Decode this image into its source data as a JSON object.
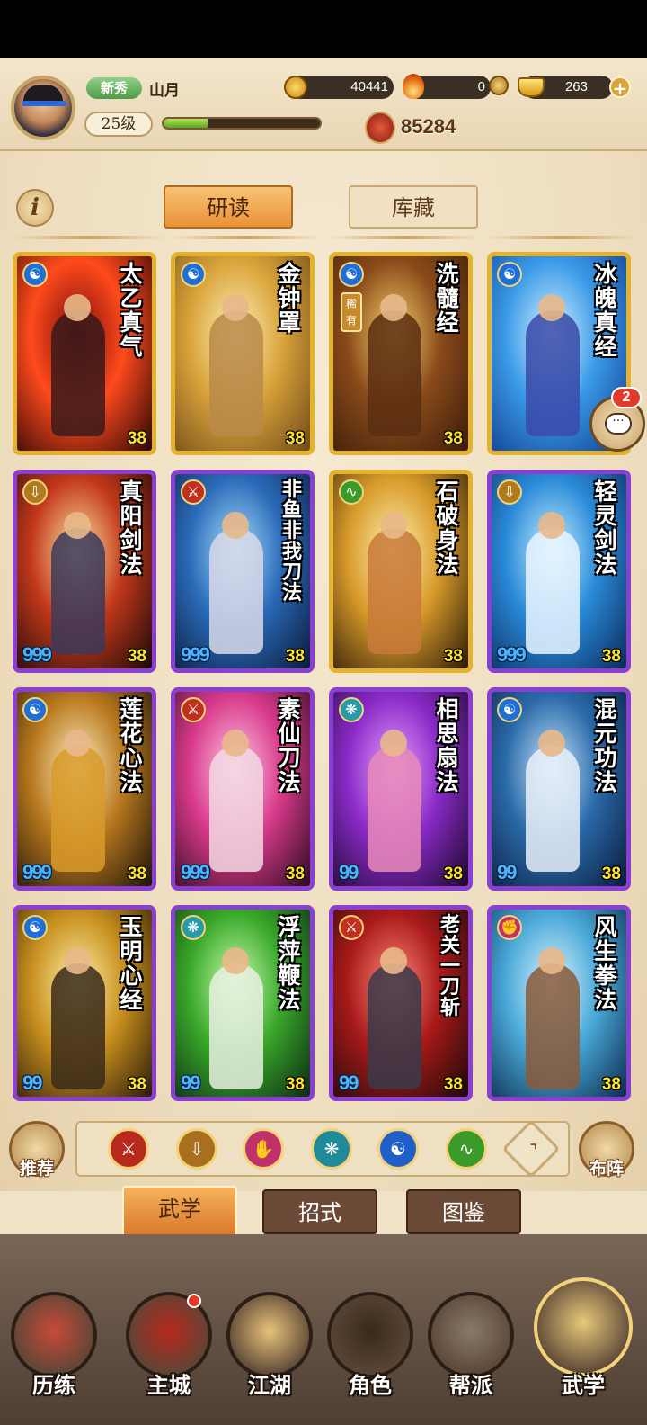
{
  "player": {
    "rank_badge": "新秀",
    "name": "山月",
    "level": "25级",
    "xp_fraction": 0.28
  },
  "currencies": {
    "coins": "40441",
    "flame": "0",
    "ingots": "263"
  },
  "power": "85284",
  "tabs": {
    "study": "研读",
    "storage": "库藏"
  },
  "chat_badge": "2",
  "icon_glyphs": {
    "yin_yang": "☯",
    "sword": "⚔",
    "spear": "⇩",
    "fan": "❋",
    "fist": "✊",
    "palm": "✋",
    "whip": "∿",
    "up": "⌃"
  },
  "cards": [
    {
      "title": "太乙真气",
      "level": "38",
      "count": "",
      "rarity": "gold",
      "type_icon": "yin-yang-icon",
      "type_color": "#1e6fd6",
      "art": [
        "#7a0d0d",
        "#ff4a1c",
        "#2a0606"
      ],
      "fig": "#3a1a1a"
    },
    {
      "title": "金钟罩",
      "level": "38",
      "count": "",
      "rarity": "gold",
      "type_icon": "yin-yang-icon",
      "type_color": "#1e6fd6",
      "art": [
        "#fff0b8",
        "#d9a33a",
        "#6e4a18"
      ],
      "fig": "#b88a4a"
    },
    {
      "title": "洗髓经",
      "level": "38",
      "count": "",
      "rarity": "gold",
      "type_icon": "yin-yang-icon",
      "type_color": "#1e6fd6",
      "rare_tag": "稀有",
      "art": [
        "#f6d36a",
        "#8a4a1a",
        "#3a1c0a"
      ],
      "fig": "#5a2e12"
    },
    {
      "title": "冰魄真经",
      "level": "38",
      "count": "",
      "rarity": "gold",
      "type_icon": "yin-yang-icon",
      "type_color": "#1e6fd6",
      "art": [
        "#d6f2ff",
        "#3a9ae8",
        "#0e3a8a"
      ],
      "fig": "#3a4aa8"
    },
    {
      "title": "真阳剑法",
      "level": "38",
      "count": "999",
      "rarity": "purple",
      "type_icon": "sword-icon",
      "type_color": "#b07a1e",
      "art": [
        "#ffe4a0",
        "#c2381a",
        "#1a0808"
      ],
      "fig": "#3a3a5a"
    },
    {
      "title": "非鱼非我刀法",
      "level": "38",
      "count": "999",
      "rarity": "purple",
      "type_icon": "blade-icon",
      "type_color": "#c0301e",
      "art": [
        "#a8e0ff",
        "#2a6ab8",
        "#0a1a3a"
      ],
      "fig": "#d8d8e8"
    },
    {
      "title": "石破身法",
      "level": "38",
      "count": "",
      "rarity": "gold",
      "type_icon": "boot-icon",
      "type_color": "#3a9a2a",
      "art": [
        "#fff2b0",
        "#d89a2a",
        "#2a1a08"
      ],
      "fig": "#c87a3a"
    },
    {
      "title": "轻灵剑法",
      "level": "38",
      "count": "999",
      "rarity": "purple",
      "type_icon": "sword-icon",
      "type_color": "#b07a1e",
      "art": [
        "#c8f2ff",
        "#2a8ad8",
        "#0a2a5a"
      ],
      "fig": "#e8f4ff"
    },
    {
      "title": "莲花心法",
      "level": "38",
      "count": "999",
      "rarity": "purple",
      "type_icon": "yin-yang-icon",
      "type_color": "#1e6fd6",
      "art": [
        "#fff0c0",
        "#b8781e",
        "#1a1208"
      ],
      "fig": "#d89a2a"
    },
    {
      "title": "素仙刀法",
      "level": "38",
      "count": "999",
      "rarity": "purple",
      "type_icon": "blade-icon",
      "type_color": "#c0301e",
      "art": [
        "#ffc8e8",
        "#d83a8a",
        "#2a0a1e"
      ],
      "fig": "#f2d8e2"
    },
    {
      "title": "相思扇法",
      "level": "38",
      "count": "99",
      "rarity": "purple",
      "type_icon": "fan-icon",
      "type_color": "#2a9aa8",
      "art": [
        "#e8a0ff",
        "#8a2ac8",
        "#1a0828"
      ],
      "fig": "#e88ab8"
    },
    {
      "title": "混元功法",
      "level": "38",
      "count": "99",
      "rarity": "purple",
      "type_icon": "yin-yang-icon",
      "type_color": "#1e6fd6",
      "art": [
        "#c8e8ff",
        "#2a6aa8",
        "#0a1a3a"
      ],
      "fig": "#e8eef8"
    },
    {
      "title": "玉明心经",
      "level": "38",
      "count": "99",
      "rarity": "purple",
      "type_icon": "yin-yang-icon",
      "type_color": "#1e6fd6",
      "art": [
        "#fff0a8",
        "#c8901e",
        "#2a1a08"
      ],
      "fig": "#3a2a1a"
    },
    {
      "title": "浮萍鞭法",
      "level": "38",
      "count": "99",
      "rarity": "purple",
      "type_icon": "fan-icon",
      "type_color": "#2a9aa8",
      "art": [
        "#c8ffb0",
        "#3aa82a",
        "#0a2a12"
      ],
      "fig": "#e8f0e0"
    },
    {
      "title": "老关一刀斩",
      "level": "38",
      "count": "99",
      "rarity": "purple",
      "type_icon": "blade-icon",
      "type_color": "#c0301e",
      "art": [
        "#ff8a7a",
        "#a81a1a",
        "#1a0808"
      ],
      "fig": "#3a3a4a"
    },
    {
      "title": "风生拳法",
      "level": "38",
      "count": "",
      "rarity": "purple",
      "type_icon": "fist-icon",
      "type_color": "#c0306a",
      "art": [
        "#d8f4ff",
        "#4aa8d8",
        "#0a2a4a"
      ],
      "fig": "#8a5a3a"
    }
  ],
  "side_buttons": {
    "recommend": "推荐",
    "formation": "布阵"
  },
  "filters": [
    {
      "name": "blade",
      "color": "#b82a1e"
    },
    {
      "name": "sword",
      "color": "#a8701e"
    },
    {
      "name": "fist",
      "color": "#c0306a"
    },
    {
      "name": "fan",
      "color": "#1e8a9a"
    },
    {
      "name": "yin-yang",
      "color": "#1e5fc8"
    },
    {
      "name": "boot",
      "color": "#3a9a2a"
    },
    {
      "name": "up-arrow",
      "color": "#f0e4c8"
    }
  ],
  "subtabs": {
    "martial": "武学",
    "moves": "招式",
    "codex": "图鉴"
  },
  "nav": [
    "历练",
    "主城",
    "江湖",
    "角色",
    "帮派",
    "武学"
  ]
}
